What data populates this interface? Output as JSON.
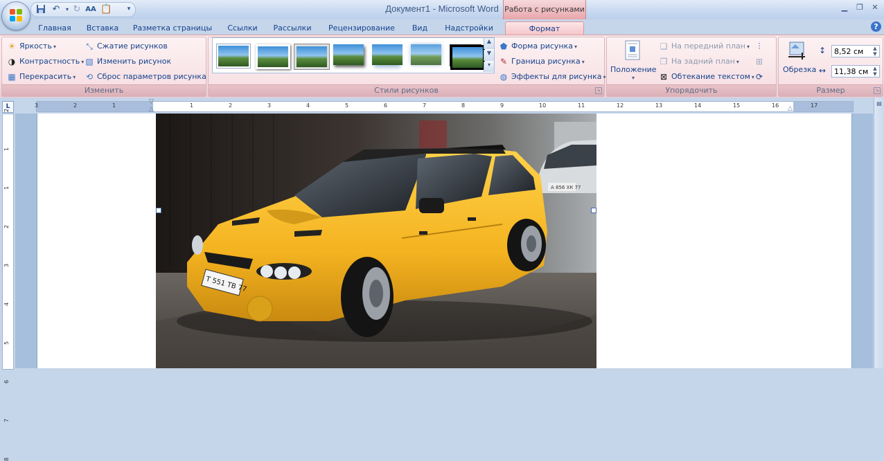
{
  "window": {
    "title": "Документ1 - Microsoft Word",
    "context_header": "Работа с рисунками",
    "buttons": [
      "minimize",
      "restore",
      "close"
    ]
  },
  "quick_access": {
    "icons": [
      "save-icon",
      "undo-icon",
      "redo-icon",
      "spelling-icon",
      "paste-icon",
      "customize-icon"
    ]
  },
  "tabs": [
    {
      "label": "Главная"
    },
    {
      "label": "Вставка"
    },
    {
      "label": "Разметка страницы"
    },
    {
      "label": "Ссылки"
    },
    {
      "label": "Рассылки"
    },
    {
      "label": "Рецензирование"
    },
    {
      "label": "Вид"
    },
    {
      "label": "Надстройки"
    },
    {
      "label": "Формат",
      "active": true
    }
  ],
  "ribbon": {
    "adjust": {
      "label": "Изменить",
      "brightness": "Яркость",
      "contrast": "Контрастность",
      "recolor": "Перекрасить",
      "compress": "Сжатие рисунков",
      "change": "Изменить рисунок",
      "reset": "Сброс параметров рисунка"
    },
    "styles": {
      "label": "Стили рисунков",
      "shape": "Форма рисунка",
      "border": "Граница рисунка",
      "effects": "Эффекты для рисунка"
    },
    "arrange": {
      "label": "Упорядочить",
      "position": "Положение",
      "bring_front": "На передний план",
      "send_back": "На задний план",
      "wrap": "Обтекание текстом"
    },
    "size": {
      "label": "Размер",
      "crop": "Обрезка",
      "height": "8,52 см",
      "width": "11,38 см"
    }
  },
  "ruler": {
    "h_left": [
      "3",
      "2",
      "1"
    ],
    "h_right": [
      "1",
      "2",
      "3",
      "4",
      "5",
      "6",
      "7",
      "8",
      "9",
      "10",
      "11",
      "12",
      "13",
      "14",
      "15",
      "16",
      "17"
    ],
    "v": [
      "2",
      "1",
      "1",
      "2",
      "3",
      "4",
      "5",
      "6",
      "7",
      "8"
    ]
  },
  "photo": {
    "plate_front": "Т 551 ТВ 77",
    "plate_bg": "А 856 ХК 77"
  },
  "colors": {
    "ribbon_context": "#f6dfe3",
    "car_yellow": "#f4b320",
    "tab_text": "#15428b"
  }
}
